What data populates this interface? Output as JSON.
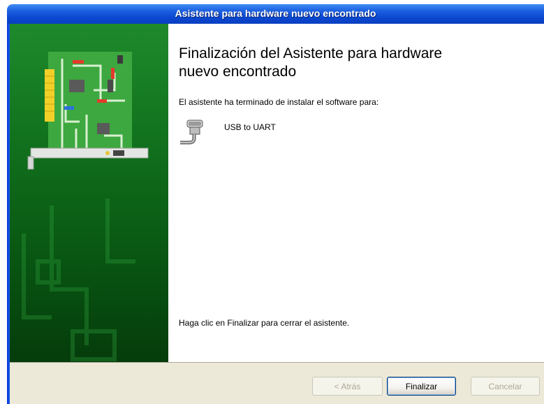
{
  "window": {
    "title": "Asistente para hardware nuevo encontrado"
  },
  "content": {
    "heading": "Finalización del Asistente para hardware nuevo encontrado",
    "intro": "El asistente ha terminado de instalar el software para:",
    "device": {
      "name": "USB to UART",
      "icon": "serial-port-icon"
    },
    "finish_hint": "Haga clic en Finalizar para cerrar el asistente."
  },
  "buttons": {
    "back": "< Atrás",
    "finish": "Finalizar",
    "cancel": "Cancelar"
  },
  "colors": {
    "title_bar": "#0b47d1",
    "side_panel": "#11711d",
    "footer": "#ece9d8"
  }
}
